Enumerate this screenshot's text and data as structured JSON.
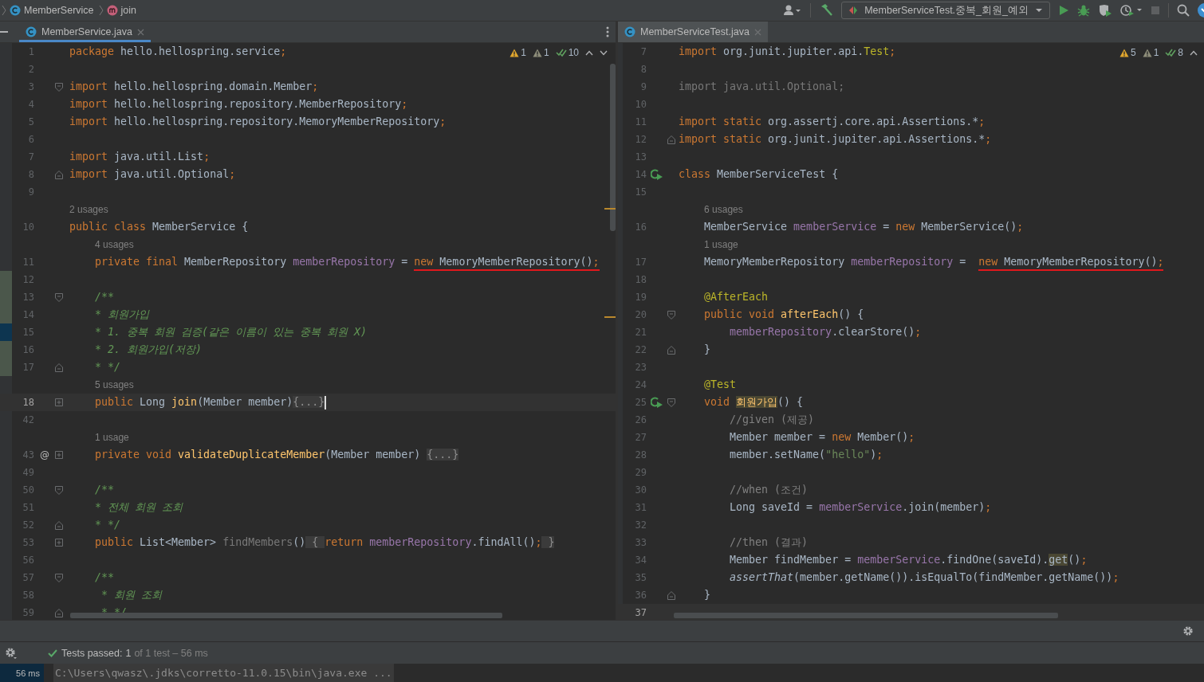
{
  "breadcrumbs": [
    {
      "kind": "class",
      "label": "MemberService"
    },
    {
      "kind": "method",
      "label": "join"
    }
  ],
  "toolbar": {
    "run_config": "MemberServiceTest.중복_회원_예외",
    "stop_disabled": true
  },
  "editors": [
    {
      "tab": {
        "label": "MemberService.java",
        "selected": true
      },
      "inspections": [
        {
          "kind": "warning",
          "count": "1"
        },
        {
          "kind": "weak",
          "count": "1"
        },
        {
          "kind": "ok",
          "count": "10"
        }
      ],
      "nav": [
        {
          "kind": "up"
        },
        {
          "kind": "down"
        }
      ],
      "lines": [
        {
          "n": "1",
          "t": [
            {
              "text": "package ",
              "kind": "kw"
            },
            {
              "text": "hello.hellospring.service",
              "kind": "p"
            },
            {
              "text": ";",
              "kind": "kw"
            }
          ]
        },
        {
          "n": "2"
        },
        {
          "n": "3",
          "fold": {
            "kind": "open"
          },
          "t": [
            {
              "text": "import ",
              "kind": "kw"
            },
            {
              "text": "hello.hellospring.domain.Member",
              "kind": "p"
            },
            {
              "text": ";",
              "kind": "kw"
            }
          ]
        },
        {
          "n": "4",
          "t": [
            {
              "text": "import ",
              "kind": "kw"
            },
            {
              "text": "hello.hellospring.repository.MemberRepository",
              "kind": "p"
            },
            {
              "text": ";",
              "kind": "kw"
            }
          ]
        },
        {
          "n": "5",
          "t": [
            {
              "text": "import ",
              "kind": "kw"
            },
            {
              "text": "hello.hellospring.repository.MemoryMemberRepository",
              "kind": "p"
            },
            {
              "text": ";",
              "kind": "kw"
            }
          ]
        },
        {
          "n": "6"
        },
        {
          "n": "7",
          "t": [
            {
              "text": "import ",
              "kind": "kw"
            },
            {
              "text": "java.util.List",
              "kind": "p"
            },
            {
              "text": ";",
              "kind": "kw"
            }
          ]
        },
        {
          "n": "8",
          "fold": {
            "kind": "close"
          },
          "t": [
            {
              "text": "import ",
              "kind": "kw"
            },
            {
              "text": "java.util.Optional",
              "kind": "p"
            },
            {
              "text": ";",
              "kind": "kw"
            }
          ]
        },
        {
          "n": "9"
        },
        {
          "n": "10",
          "hint": "2 usages",
          "t": [
            {
              "text": "public class ",
              "kind": "kw"
            },
            {
              "text": "MemberService {",
              "kind": "p"
            }
          ]
        },
        {
          "n": "11",
          "hint": "4 usages",
          "t": [
            {
              "text": "    private final ",
              "kind": "kw"
            },
            {
              "text": "MemberRepository ",
              "kind": "p"
            },
            {
              "text": "memberRepository",
              "kind": "fld"
            },
            {
              "text": " = ",
              "kind": "p"
            },
            {
              "text": "new ",
              "kind": "kw",
              "underlined": true
            },
            {
              "text": "MemoryMemberRepository()",
              "kind": "p",
              "underlined": true
            },
            {
              "text": ";",
              "kind": "kw",
              "underlined": true
            }
          ]
        },
        {
          "n": "12",
          "vcs": {
            "kind": "added"
          }
        },
        {
          "n": "13",
          "vcs": {
            "kind": "added"
          },
          "fold": {
            "kind": "open"
          },
          "t": [
            {
              "text": "    /**",
              "kind": "cm"
            }
          ]
        },
        {
          "n": "14",
          "vcs": {
            "kind": "added"
          },
          "t": [
            {
              "text": "    * 회원가입",
              "kind": "cm"
            }
          ]
        },
        {
          "n": "15",
          "vcs": {
            "kind": "modified"
          },
          "t": [
            {
              "text": "    * 1. 중복 회원 검증(같은 이름이 있는 중복 회원 X)",
              "kind": "cm"
            }
          ]
        },
        {
          "n": "16",
          "vcs": {
            "kind": "added"
          },
          "t": [
            {
              "text": "    * 2. 회원가입(저장)",
              "kind": "cm"
            }
          ]
        },
        {
          "n": "17",
          "vcs": {
            "kind": "added"
          },
          "fold": {
            "kind": "close"
          },
          "t": [
            {
              "text": "    * */",
              "kind": "cm"
            }
          ]
        },
        {
          "n": "18",
          "hint": "5 usages",
          "fold": {
            "kind": "collapsed"
          },
          "current": true,
          "caret": true,
          "t": [
            {
              "text": "    public ",
              "kind": "kw"
            },
            {
              "text": "Long ",
              "kind": "p"
            },
            {
              "text": "join",
              "kind": "fn"
            },
            {
              "text": "(Member member)",
              "kind": "p"
            },
            {
              "text": "{...}",
              "kind": "fold"
            }
          ]
        },
        {
          "n": "42"
        },
        {
          "n": "43",
          "hint": "1 usage",
          "gutter_text": "@",
          "fold": {
            "kind": "collapsed"
          },
          "t": [
            {
              "text": "    private void ",
              "kind": "kw"
            },
            {
              "text": "validateDuplicateMember",
              "kind": "fn"
            },
            {
              "text": "(Member member) ",
              "kind": "p"
            },
            {
              "text": "{...}",
              "kind": "fold"
            }
          ]
        },
        {
          "n": "49"
        },
        {
          "n": "50",
          "fold": {
            "kind": "open"
          },
          "t": [
            {
              "text": "    /**",
              "kind": "cm"
            }
          ]
        },
        {
          "n": "51",
          "t": [
            {
              "text": "    * 전체 회원 조회",
              "kind": "cm"
            }
          ]
        },
        {
          "n": "52",
          "fold": {
            "kind": "close"
          },
          "t": [
            {
              "text": "    * */",
              "kind": "cm"
            }
          ]
        },
        {
          "n": "53",
          "fold": {
            "kind": "collapsed"
          },
          "t": [
            {
              "text": "    public ",
              "kind": "kw"
            },
            {
              "text": "List<Member> ",
              "kind": "p"
            },
            {
              "text": "findMembers",
              "kind": "dim"
            },
            {
              "text": "()",
              "kind": "p"
            },
            {
              "text": " { ",
              "kind": "fold"
            },
            {
              "text": "return ",
              "kind": "kw"
            },
            {
              "text": "memberRepository",
              "kind": "fld"
            },
            {
              "text": ".findAll()",
              "kind": "p"
            },
            {
              "text": ";",
              "kind": "kw"
            },
            {
              "text": " }",
              "kind": "fold"
            }
          ]
        },
        {
          "n": "56"
        },
        {
          "n": "57",
          "fold": {
            "kind": "open"
          },
          "t": [
            {
              "text": "    /**",
              "kind": "cm"
            }
          ]
        },
        {
          "n": "58",
          "t": [
            {
              "text": "     * 회원 조회",
              "kind": "cm"
            }
          ]
        },
        {
          "n": "59",
          "fold": {
            "kind": "close"
          },
          "t": [
            {
              "text": "     * */",
              "kind": "cm"
            }
          ]
        }
      ]
    },
    {
      "tab": {
        "label": "MemberServiceTest.java",
        "selected": false
      },
      "inspections": [
        {
          "kind": "warning",
          "count": "5"
        },
        {
          "kind": "weak",
          "count": "1"
        },
        {
          "kind": "ok",
          "count": "8"
        }
      ],
      "nav": [
        {
          "kind": "up"
        }
      ],
      "lines": [
        {
          "n": "7",
          "t": [
            {
              "text": "import ",
              "kind": "kw"
            },
            {
              "text": "org.junit.jupiter.api.",
              "kind": "p"
            },
            {
              "text": "Test",
              "kind": "ann"
            },
            {
              "text": ";",
              "kind": "kw"
            }
          ]
        },
        {
          "n": "8"
        },
        {
          "n": "9",
          "t": [
            {
              "text": "import java.util.Optional;",
              "kind": "dim"
            }
          ]
        },
        {
          "n": "10"
        },
        {
          "n": "11",
          "t": [
            {
              "text": "import static ",
              "kind": "kw"
            },
            {
              "text": "org.assertj.core.api.Assertions.*",
              "kind": "p"
            },
            {
              "text": ";",
              "kind": "kw"
            }
          ]
        },
        {
          "n": "12",
          "fold": {
            "kind": "close"
          },
          "t": [
            {
              "text": "import static ",
              "kind": "kw"
            },
            {
              "text": "org.junit.jupiter.api.Assertions.*",
              "kind": "p"
            },
            {
              "text": ";",
              "kind": "kw"
            }
          ]
        },
        {
          "n": "13"
        },
        {
          "n": "14",
          "run": true,
          "t": [
            {
              "text": "class ",
              "kind": "kw"
            },
            {
              "text": "MemberServiceTest {",
              "kind": "p"
            }
          ]
        },
        {
          "n": "15"
        },
        {
          "n": "16",
          "hint": "6 usages",
          "t": [
            {
              "text": "    MemberService ",
              "kind": "p"
            },
            {
              "text": "memberService",
              "kind": "fld"
            },
            {
              "text": " = ",
              "kind": "p"
            },
            {
              "text": "new ",
              "kind": "kw"
            },
            {
              "text": "MemberService()",
              "kind": "p"
            },
            {
              "text": ";",
              "kind": "kw"
            }
          ]
        },
        {
          "n": "17",
          "hint": "1 usage",
          "t": [
            {
              "text": "    MemoryMemberRepository ",
              "kind": "p"
            },
            {
              "text": "memberRepository",
              "kind": "fld"
            },
            {
              "text": " =  ",
              "kind": "p"
            },
            {
              "text": "new ",
              "kind": "kw",
              "underlined": true
            },
            {
              "text": "MemoryMemberRepository()",
              "kind": "p",
              "underlined": true
            },
            {
              "text": ";",
              "kind": "kw",
              "underlined": true
            }
          ]
        },
        {
          "n": "18"
        },
        {
          "n": "19",
          "t": [
            {
              "text": "    @AfterEach",
              "kind": "ann"
            }
          ]
        },
        {
          "n": "20",
          "fold": {
            "kind": "open"
          },
          "t": [
            {
              "text": "    public void ",
              "kind": "kw"
            },
            {
              "text": "afterEach",
              "kind": "fn"
            },
            {
              "text": "() {",
              "kind": "p"
            }
          ]
        },
        {
          "n": "21",
          "t": [
            {
              "text": "        memberRepository",
              "kind": "fld"
            },
            {
              "text": ".clearStore()",
              "kind": "p"
            },
            {
              "text": ";",
              "kind": "kw"
            }
          ]
        },
        {
          "n": "22",
          "fold": {
            "kind": "close"
          },
          "t": [
            {
              "text": "    }",
              "kind": "p"
            }
          ]
        },
        {
          "n": "23"
        },
        {
          "n": "24",
          "t": [
            {
              "text": "    @Test",
              "kind": "ann"
            }
          ]
        },
        {
          "n": "25",
          "run": true,
          "fold": {
            "kind": "open"
          },
          "t": [
            {
              "text": "    void ",
              "kind": "kw"
            },
            {
              "text": "회원가입",
              "kind": "hlf"
            },
            {
              "text": "() {",
              "kind": "p"
            }
          ]
        },
        {
          "n": "26",
          "t": [
            {
              "text": "        //given (제공)",
              "kind": "lc"
            }
          ]
        },
        {
          "n": "27",
          "t": [
            {
              "text": "        Member member = ",
              "kind": "p"
            },
            {
              "text": "new ",
              "kind": "kw"
            },
            {
              "text": "Member()",
              "kind": "p"
            },
            {
              "text": ";",
              "kind": "kw"
            }
          ]
        },
        {
          "n": "28",
          "t": [
            {
              "text": "        member.setName(",
              "kind": "p"
            },
            {
              "text": "\"hello\"",
              "kind": "str"
            },
            {
              "text": ")",
              "kind": "p"
            },
            {
              "text": ";",
              "kind": "kw"
            }
          ]
        },
        {
          "n": "29"
        },
        {
          "n": "30",
          "t": [
            {
              "text": "        //when (조건)",
              "kind": "lc"
            }
          ]
        },
        {
          "n": "31",
          "t": [
            {
              "text": "        Long saveId = ",
              "kind": "p"
            },
            {
              "text": "memberService",
              "kind": "fld"
            },
            {
              "text": ".join(member)",
              "kind": "p"
            },
            {
              "text": ";",
              "kind": "kw"
            }
          ]
        },
        {
          "n": "32"
        },
        {
          "n": "33",
          "t": [
            {
              "text": "        //then (결과)",
              "kind": "lc"
            }
          ]
        },
        {
          "n": "34",
          "t": [
            {
              "text": "        Member findMember = ",
              "kind": "p"
            },
            {
              "text": "memberService",
              "kind": "fld"
            },
            {
              "text": ".findOne(saveId).",
              "kind": "p"
            },
            {
              "text": "get",
              "kind": "hl"
            },
            {
              "text": "()",
              "kind": "p"
            },
            {
              "text": ";",
              "kind": "kw"
            }
          ]
        },
        {
          "n": "35",
          "t": [
            {
              "text": "        assertThat",
              "kind": "it"
            },
            {
              "text": "(member.getName()).isEqualTo(findMember.getName())",
              "kind": "p"
            },
            {
              "text": ";",
              "kind": "kw"
            }
          ]
        },
        {
          "n": "36",
          "fold": {
            "kind": "close"
          },
          "t": [
            {
              "text": "    }",
              "kind": "p"
            }
          ]
        },
        {
          "n": "37",
          "current": true
        }
      ]
    }
  ],
  "run_status": {
    "label": "Tests passed:",
    "passed": "1",
    "rest": "of 1 test – 56 ms"
  },
  "console": {
    "time": "56 ms",
    "command": "C:\\Users\\qwasz\\.jdks\\corretto-11.0.15\\bin\\java.exe ..."
  }
}
